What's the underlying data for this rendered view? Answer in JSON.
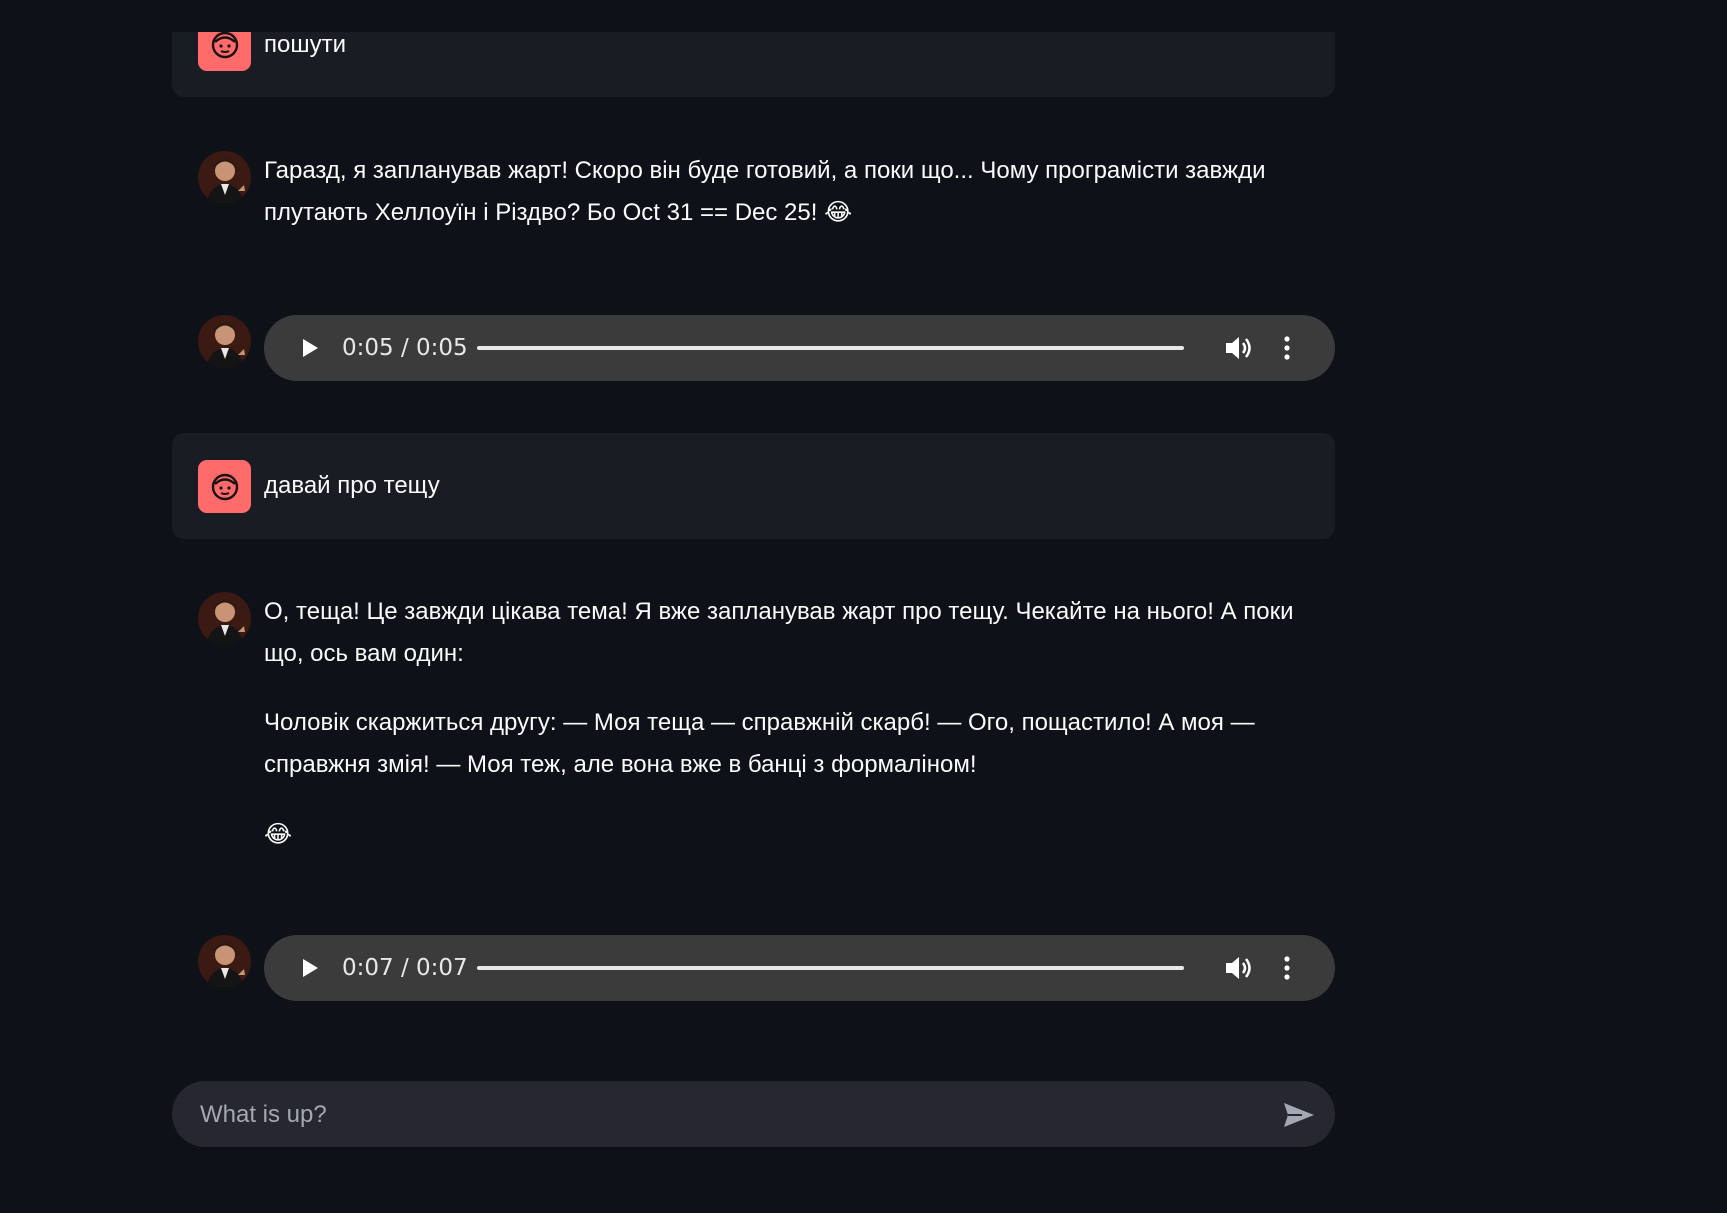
{
  "messages": [
    {
      "role": "user",
      "text": "пошути"
    },
    {
      "role": "assistant",
      "text": "Гаразд, я запланував жарт! Скоро він буде готовий, а поки що... Чому програмісти завжди плутають Хеллоуїн і Різдво? Бо Oct 31 == Dec 25! 😂"
    },
    {
      "role": "assistant",
      "audio": {
        "time": "0:05 / 0:05",
        "progress": 1.0
      }
    },
    {
      "role": "user",
      "text": "давай про тещу"
    },
    {
      "role": "assistant",
      "paragraphs": [
        "О, теща! Це завжди цікава тема! Я вже запланував жарт про тещу. Чекайте на нього! А поки що, ось вам один:",
        "Чоловік скаржиться другу: — Моя теща — справжній скарб! — Ого, пощастило! А моя — справжня змія! — Моя теж, але вона вже в банці з формаліном!",
        "😂"
      ]
    },
    {
      "role": "assistant",
      "audio": {
        "time": "0:07 / 0:07",
        "progress": 1.0
      }
    }
  ],
  "chat_input": {
    "placeholder": "What is up?"
  },
  "icons": {
    "user_avatar": "smiley-face-icon",
    "bot_avatar": "portrait-avatar",
    "play": "play-icon",
    "volume": "volume-icon",
    "more": "more-vertical-icon",
    "send": "send-icon"
  },
  "colors": {
    "background": "#0e1117",
    "user_message_bg": "#1a1c24",
    "user_avatar": "#ff6b6b",
    "audio_player_bg": "#3b3b3b",
    "input_bg": "#262730"
  }
}
